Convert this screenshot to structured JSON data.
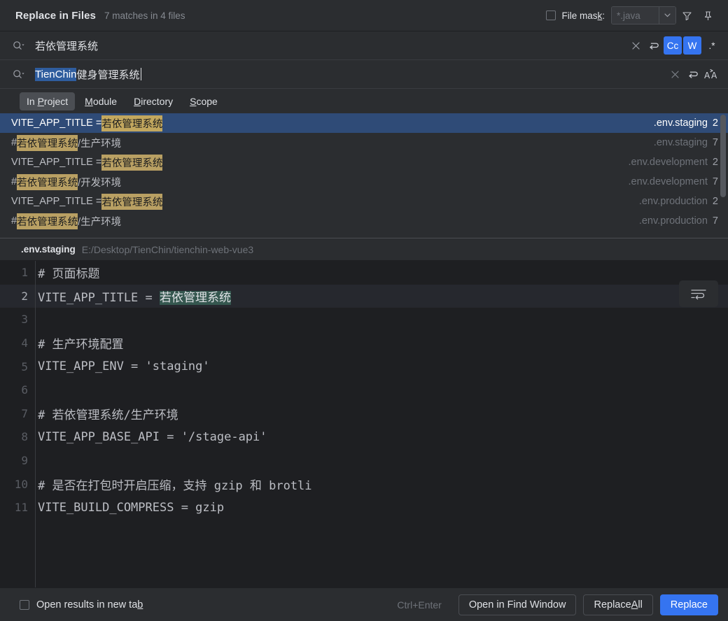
{
  "header": {
    "title": "Replace in Files",
    "match_summary": "7 matches in 4 files",
    "file_mask_label_a": "File mas",
    "file_mask_label_b": "k",
    "file_mask_label_c": ":",
    "file_mask_value": "*.java",
    "filter_icon": "filter-icon",
    "pin_icon": "pin-icon",
    "chevron_icon": "chevron-down-icon"
  },
  "search": {
    "query": "若依管理系统",
    "clear_icon": "close-icon",
    "history_icon": "history-icon",
    "match_case": "Cc",
    "words": "W",
    "regex": ".*"
  },
  "replace": {
    "selected_text": "TienChin",
    "rest_text": " 健身管理系统",
    "clear_icon": "close-icon",
    "history_icon": "history-icon",
    "preserve_case": "AA"
  },
  "scope_tabs": [
    {
      "pre": "In ",
      "mnemonic": "P",
      "post": "roject",
      "active": true
    },
    {
      "pre": "",
      "mnemonic": "M",
      "post": "odule",
      "active": false
    },
    {
      "pre": "",
      "mnemonic": "D",
      "post": "irectory",
      "active": false
    },
    {
      "pre": "",
      "mnemonic": "S",
      "post": "cope",
      "active": false
    }
  ],
  "results": [
    {
      "prefix": "VITE_APP_TITLE = ",
      "match": "若依管理系统",
      "suffix": "",
      "file": ".env.staging",
      "line": "2",
      "selected": true
    },
    {
      "prefix": "# ",
      "match": "若依管理系统",
      "suffix": "/生产环境",
      "file": ".env.staging",
      "line": "7",
      "selected": false
    },
    {
      "prefix": "VITE_APP_TITLE = ",
      "match": "若依管理系统",
      "suffix": "",
      "file": ".env.development",
      "line": "2",
      "selected": false
    },
    {
      "prefix": "# ",
      "match": "若依管理系统",
      "suffix": "/开发环境",
      "file": ".env.development",
      "line": "7",
      "selected": false
    },
    {
      "prefix": "VITE_APP_TITLE = ",
      "match": "若依管理系统",
      "suffix": "",
      "file": ".env.production",
      "line": "2",
      "selected": false
    },
    {
      "prefix": "# ",
      "match": "若依管理系统",
      "suffix": "/生产环境",
      "file": ".env.production",
      "line": "7",
      "selected": false
    }
  ],
  "preview": {
    "file_name": ".env.staging",
    "file_dir": "E:/Desktop/TienChin/tienchin-web-vue3",
    "wrap_icon": "soft-wrap-icon",
    "lines": [
      {
        "num": "1",
        "pre": "# 页面标题",
        "match": "",
        "post": "",
        "current": false
      },
      {
        "num": "2",
        "pre": "VITE_APP_TITLE = ",
        "match": "若依管理系统",
        "post": "",
        "current": true
      },
      {
        "num": "3",
        "pre": "",
        "match": "",
        "post": "",
        "current": false
      },
      {
        "num": "4",
        "pre": "# 生产环境配置",
        "match": "",
        "post": "",
        "current": false
      },
      {
        "num": "5",
        "pre": "VITE_APP_ENV = 'staging'",
        "match": "",
        "post": "",
        "current": false
      },
      {
        "num": "6",
        "pre": "",
        "match": "",
        "post": "",
        "current": false
      },
      {
        "num": "7",
        "pre": "# 若依管理系统/生产环境",
        "match": "",
        "post": "",
        "current": false
      },
      {
        "num": "8",
        "pre": "VITE_APP_BASE_API = '/stage-api'",
        "match": "",
        "post": "",
        "current": false
      },
      {
        "num": "9",
        "pre": "",
        "match": "",
        "post": "",
        "current": false
      },
      {
        "num": "10",
        "pre": "# 是否在打包时开启压缩，支持 gzip 和 brotli",
        "match": "",
        "post": "",
        "current": false
      },
      {
        "num": "11",
        "pre": "VITE_BUILD_COMPRESS = gzip",
        "match": "",
        "post": "",
        "current": false
      }
    ]
  },
  "footer": {
    "open_new_tab_pre": "Open results in new ta",
    "open_new_tab_mnemonic": "b",
    "shortcut": "Ctrl+Enter",
    "open_find_window": "Open in Find Window",
    "replace_all_pre": "Replace ",
    "replace_all_mnemonic": "A",
    "replace_all_post": "ll",
    "replace": "Replace"
  },
  "colors": {
    "accent": "#3574f0",
    "selection": "#2f4b77",
    "match_highlight": "#b9a063",
    "editor_match": "#35574f",
    "background": "#2b2d30",
    "editor_background": "#1e1f22"
  }
}
